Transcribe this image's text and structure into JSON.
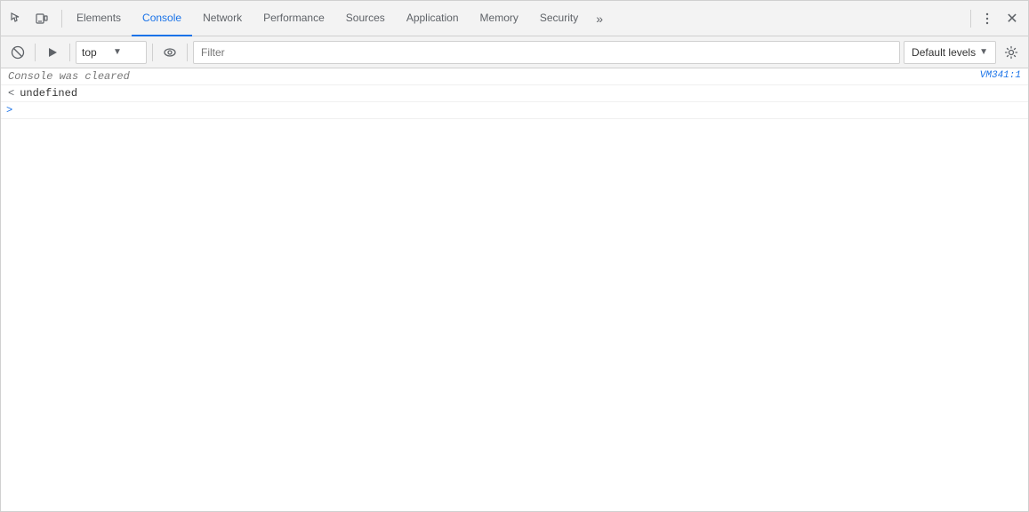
{
  "toolbar": {
    "icons": {
      "inspect": "⬚",
      "device": "⬜"
    },
    "tabs": [
      {
        "label": "Elements",
        "active": false
      },
      {
        "label": "Console",
        "active": true
      },
      {
        "label": "Network",
        "active": false
      },
      {
        "label": "Performance",
        "active": false
      },
      {
        "label": "Sources",
        "active": false
      },
      {
        "label": "Application",
        "active": false
      },
      {
        "label": "Memory",
        "active": false
      },
      {
        "label": "Security",
        "active": false
      }
    ],
    "more_label": "»",
    "menu_label": "⋮",
    "close_label": "✕"
  },
  "console_toolbar": {
    "clear_label": "🚫",
    "context_value": "top",
    "context_arrow": "▼",
    "eye_label": "👁",
    "filter_placeholder": "Filter",
    "levels_label": "Default levels",
    "levels_arrow": "▼",
    "settings_label": "⚙"
  },
  "console": {
    "cleared_message": "Console was cleared",
    "cleared_link": "VM341:1",
    "undefined_prefix": "<",
    "undefined_value": "undefined",
    "arrow_icon": ">"
  }
}
